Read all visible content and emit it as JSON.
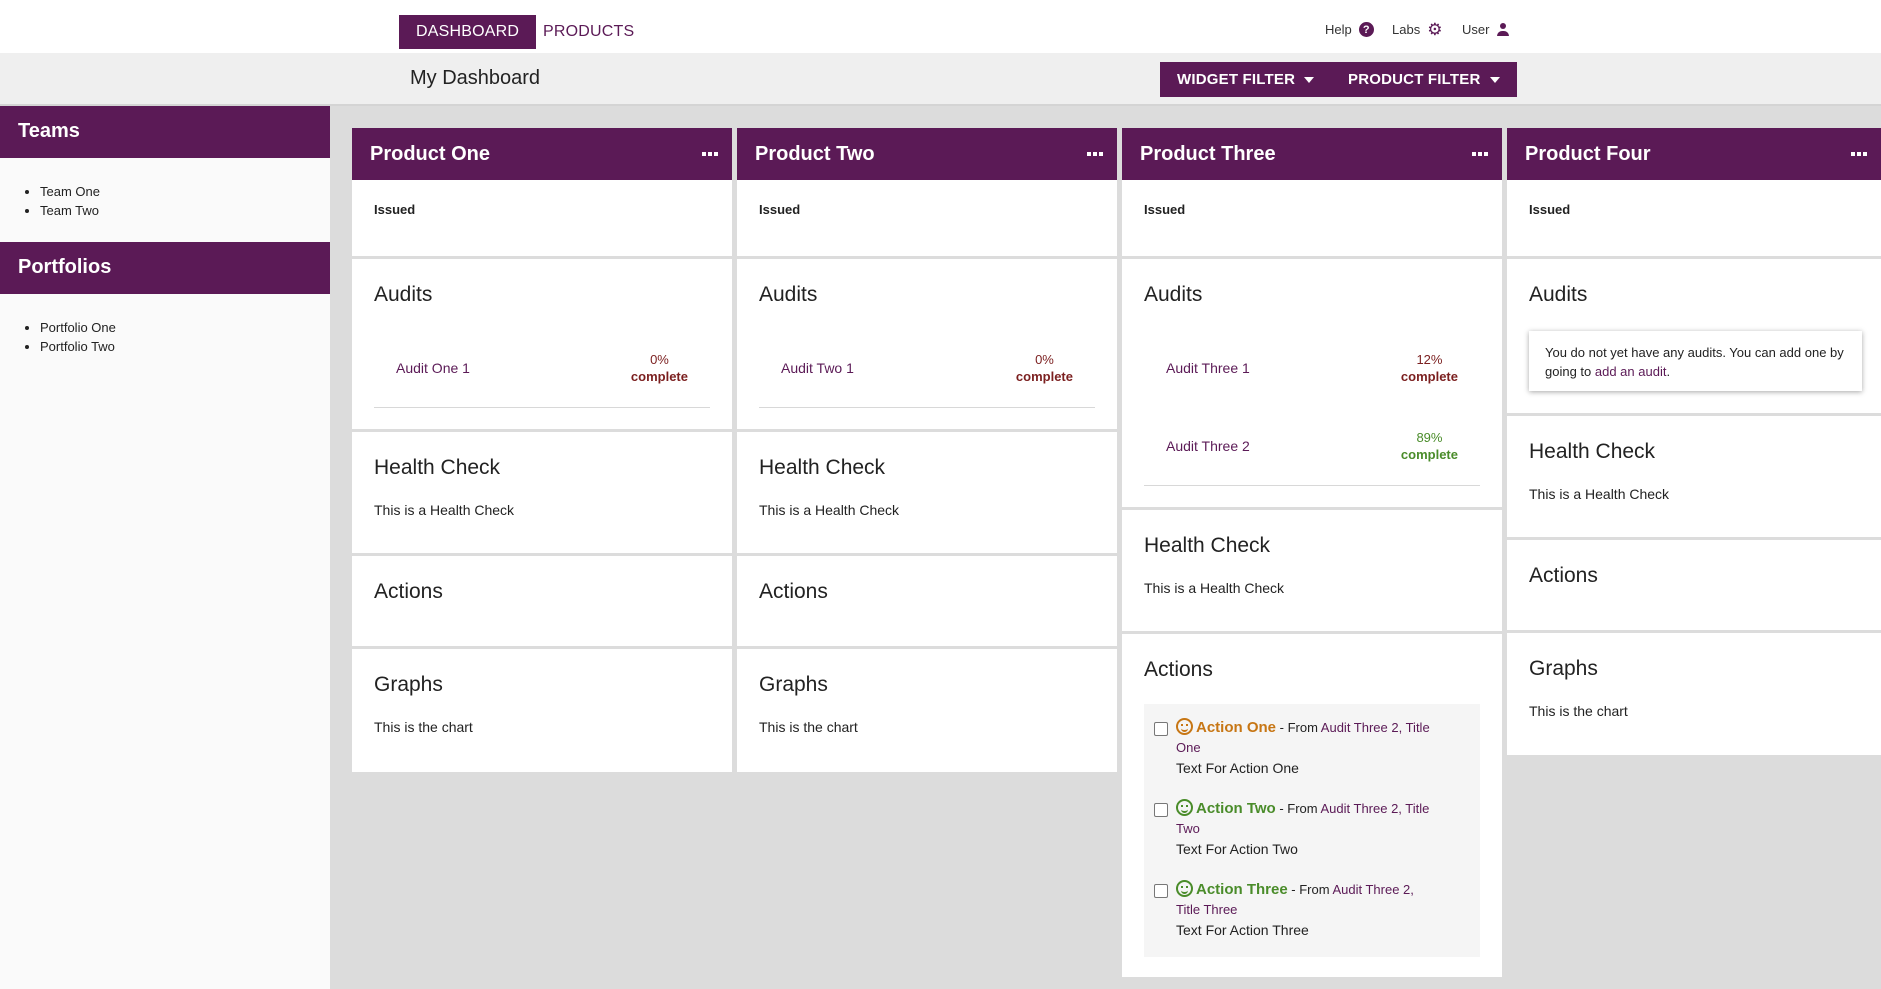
{
  "nav": {
    "tabs": [
      {
        "label": "DASHBOARD"
      },
      {
        "label": "PRODUCTS"
      }
    ],
    "help": "Help",
    "labs": "Labs",
    "user": "User"
  },
  "header": {
    "title": "My Dashboard",
    "widget_filter": "WIDGET FILTER",
    "product_filter": "PRODUCT FILTER"
  },
  "sidebar": {
    "teams": {
      "title": "Teams",
      "items": [
        "Team One",
        "Team Two"
      ]
    },
    "portfolios": {
      "title": "Portfolios",
      "items": [
        "Portfolio One",
        "Portfolio Two"
      ]
    }
  },
  "colors": {
    "brand": "#5b1a56",
    "incomplete": "#7b1f1f",
    "complete": "#4a8c2a",
    "warning": "#c77614"
  },
  "products": [
    {
      "title": "Product One",
      "issued": "Issued",
      "audits_title": "Audits",
      "audits": [
        {
          "name": "Audit One 1",
          "pct": "0%",
          "status": "complete"
        }
      ],
      "health_title": "Health Check",
      "health_text": "This is a Health Check",
      "actions_title": "Actions",
      "graphs_title": "Graphs",
      "graphs_text": "This is the chart"
    },
    {
      "title": "Product Two",
      "issued": "Issued",
      "audits_title": "Audits",
      "audits": [
        {
          "name": "Audit Two 1",
          "pct": "0%",
          "status": "complete"
        }
      ],
      "health_title": "Health Check",
      "health_text": "This is a Health Check",
      "actions_title": "Actions",
      "graphs_title": "Graphs",
      "graphs_text": "This is the chart"
    },
    {
      "title": "Product Three",
      "issued": "Issued",
      "audits_title": "Audits",
      "audits": [
        {
          "name": "Audit Three 1",
          "pct": "12%",
          "status": "complete"
        },
        {
          "name": "Audit Three 2",
          "pct": "89%",
          "status": "complete"
        }
      ],
      "health_title": "Health Check",
      "health_text": "This is a Health Check",
      "actions_title": "Actions",
      "actions": [
        {
          "name": "Action One",
          "from": " - From ",
          "source_a": "Audit Three 2, Title",
          "source_b": "One",
          "text": "Text For Action One"
        },
        {
          "name": "Action Two",
          "from": " - From ",
          "source_a": "Audit Three 2, Title",
          "source_b": "Two",
          "text": "Text For Action Two"
        },
        {
          "name": "Action Three",
          "from": " - From ",
          "source_a": "Audit Three 2,",
          "source_b": "Title Three",
          "text": "Text For Action Three"
        }
      ]
    },
    {
      "title": "Product Four",
      "issued": "Issued",
      "audits_title": "Audits",
      "empty_audits_prefix": "You do not yet have any audits. You can add one by going to ",
      "empty_audits_link": "add an audit",
      "empty_audits_suffix": ".",
      "health_title": "Health Check",
      "health_text": "This is a Health Check",
      "actions_title": "Actions",
      "graphs_title": "Graphs",
      "graphs_text": "This is the chart"
    }
  ]
}
